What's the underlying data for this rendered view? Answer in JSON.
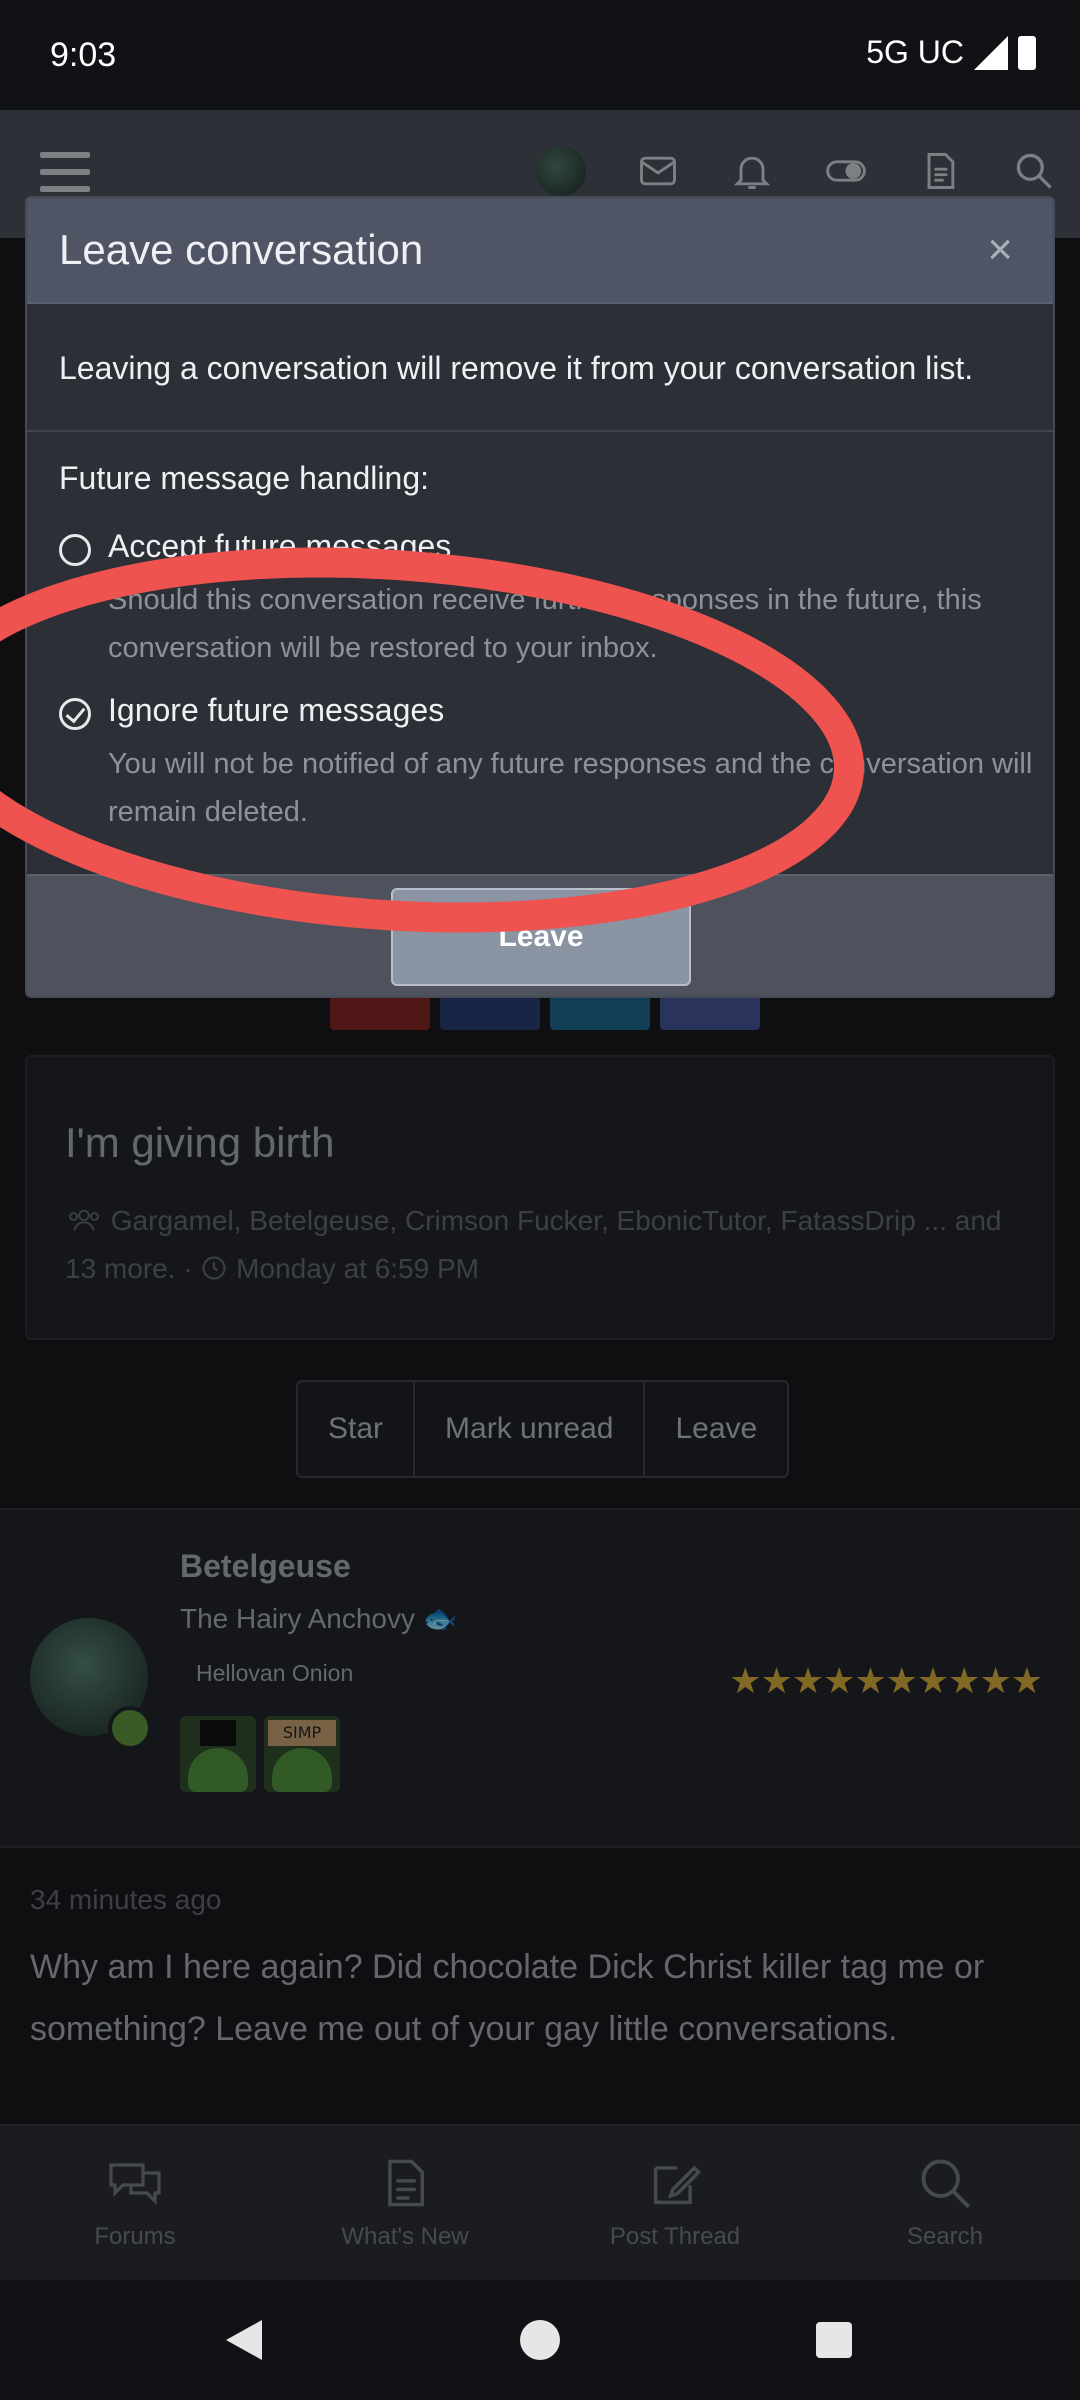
{
  "status_bar": {
    "time": "9:03",
    "network": "5G UC"
  },
  "modal": {
    "title": "Leave conversation",
    "close_label": "×",
    "note": "Leaving a conversation will remove it from your conversation list.",
    "future_label": "Future message handling:",
    "options": [
      {
        "title": "Accept future messages",
        "description": "Should this conversation receive further responses in the future, this conversation will be restored to your inbox.",
        "checked": false
      },
      {
        "title": "Ignore future messages",
        "description": "You will not be notified of any future responses and the conversation will remain deleted.",
        "checked": true
      }
    ],
    "submit_label": "Leave"
  },
  "conversation": {
    "title": "I'm giving birth",
    "participants": "Gargamel, Betelgeuse, Crimson Fucker, EbonicTutor, FatassDrip ...",
    "more": "and 13 more.",
    "separator": "·",
    "date": "Monday at 6:59 PM"
  },
  "actions": {
    "star": "Star",
    "mark_unread": "Mark unread",
    "leave": "Leave"
  },
  "post": {
    "username": "Betelgeuse",
    "user_title": "The Hairy Anchovy",
    "user_banner": "Hellovan Onion",
    "badge_sign": "SIMP",
    "stars": "★★★★★★★★★★",
    "time": "34 minutes ago",
    "body": "Why am I here again? Did chocolate Dick Christ killer tag me or something? Leave me out of your gay little conversations."
  },
  "bottom_nav": [
    {
      "label": "Forums",
      "icon": "forums-icon"
    },
    {
      "label": "What's New",
      "icon": "whats-new-icon"
    },
    {
      "label": "Post Thread",
      "icon": "post-thread-icon"
    },
    {
      "label": "Search",
      "icon": "search-icon"
    }
  ],
  "colors": {
    "annotation": "#ee5350",
    "accent": "#8b94a3",
    "star": "#c8a03a",
    "online": "#5a8a3a"
  }
}
